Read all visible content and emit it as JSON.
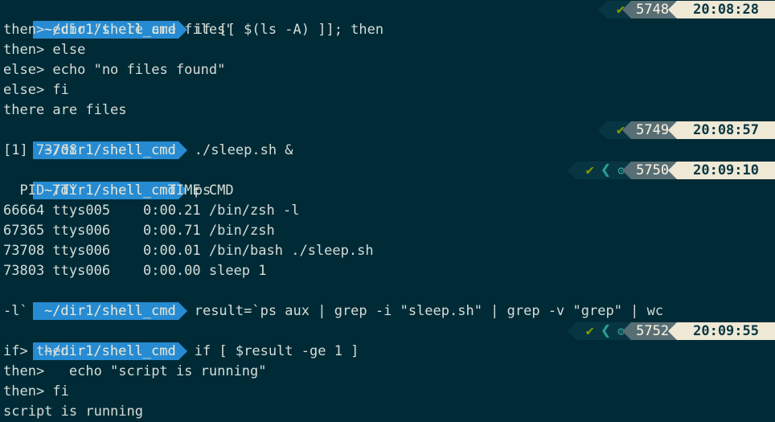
{
  "colors": {
    "background": "#002b36",
    "path_segment": "#268bd2",
    "status_ok": "#859900",
    "history_segment": "#586e75",
    "time_segment": "#eee8d5"
  },
  "icons": {
    "ok": "✔",
    "background_jobs_chevron": "❮",
    "background_jobs_gear": "⚙"
  },
  "prompts": [
    {
      "path": "~/dir1/shell_cmd",
      "command": "if [[ $(ls -A) ]]; then",
      "history": "5748",
      "time": "20:08:28"
    },
    {
      "path": "~/dir1/shell_cmd",
      "command": "./sleep.sh &",
      "history": "5749",
      "time": "20:08:57"
    },
    {
      "path": "~/dir1/shell_cmd",
      "command": "ps",
      "history": "5750",
      "time": "20:09:10"
    },
    {
      "path": "~/dir1/shell_cmd",
      "command": "result=`ps aux | grep -i \"sleep.sh\" | grep -v \"grep\" | wc",
      "command_cont": "-l`"
    },
    {
      "path": "~/dir1/shell_cmd",
      "command": "if [ $result -ge 1 ]",
      "history": "5752",
      "time": "20:09:55"
    }
  ],
  "output": {
    "block1": [
      "then> echo \"there are files\"",
      "then> else",
      "else> echo \"no files found\"",
      "else> fi",
      "there are files"
    ],
    "block2": [
      "[1] 73708"
    ],
    "block3": [
      "  PID TTY           TIME CMD",
      "66664 ttys005    0:00.21 /bin/zsh -l",
      "67365 ttys006    0:00.71 /bin/zsh",
      "73708 ttys006    0:00.01 /bin/bash ./sleep.sh",
      "73803 ttys006    0:00.00 sleep 1"
    ],
    "block5": [
      "if> then",
      "then>   echo \"script is running\"",
      "then> fi",
      "script is running"
    ]
  }
}
